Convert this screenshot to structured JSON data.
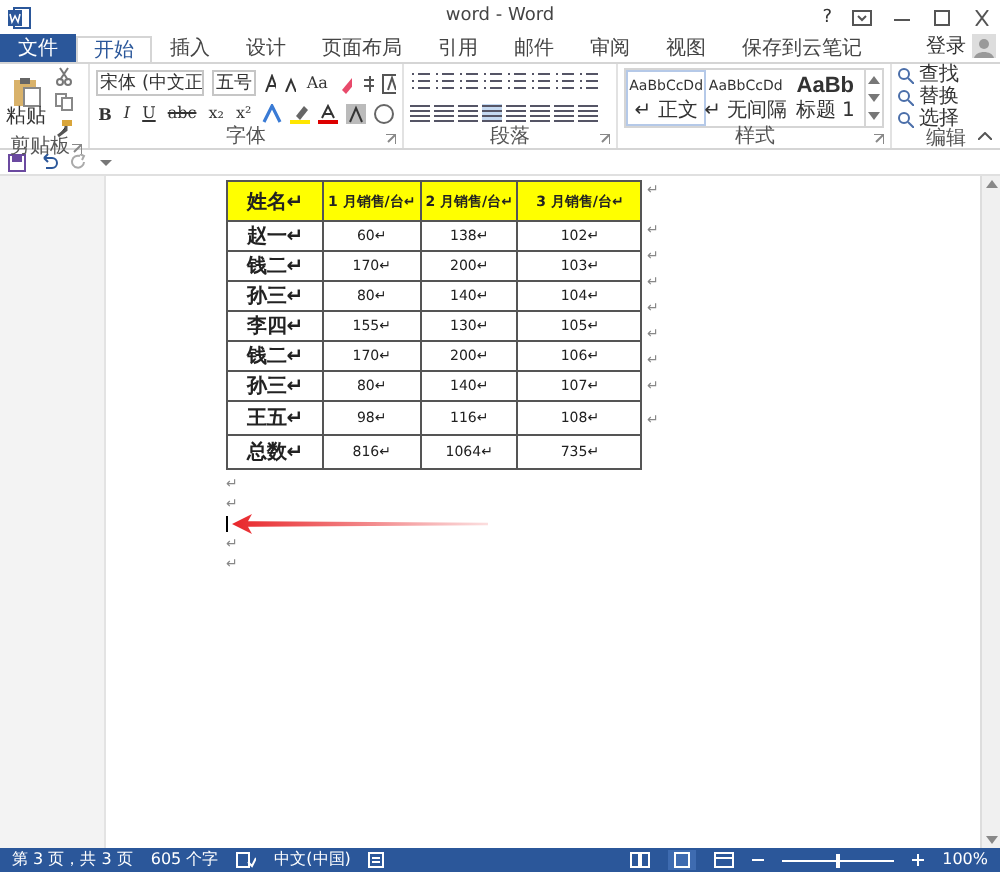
{
  "window": {
    "title": "word - Word",
    "help": "?"
  },
  "tabs": [
    {
      "label": "文件",
      "kind": "file",
      "selected": false
    },
    {
      "label": "开始",
      "kind": "tab",
      "selected": true
    },
    {
      "label": "插入",
      "kind": "tab",
      "selected": false
    },
    {
      "label": "设计",
      "kind": "tab",
      "selected": false
    },
    {
      "label": "页面布局",
      "kind": "tab",
      "selected": false
    },
    {
      "label": "引用",
      "kind": "tab",
      "selected": false
    },
    {
      "label": "邮件",
      "kind": "tab",
      "selected": false
    },
    {
      "label": "审阅",
      "kind": "tab",
      "selected": false
    },
    {
      "label": "视图",
      "kind": "tab",
      "selected": false
    },
    {
      "label": "保存到云笔记",
      "kind": "tab",
      "selected": false
    }
  ],
  "account": {
    "login": "登录"
  },
  "ribbon": {
    "clipboard": {
      "paste": "粘贴",
      "label": "剪贴板"
    },
    "font": {
      "name": "宋体 (中文正",
      "size": "五号",
      "case": "Aa",
      "row2": [
        "B",
        "I",
        "U",
        "abc",
        "x₂",
        "x²"
      ],
      "label": "字体"
    },
    "paragraph": {
      "label": "段落"
    },
    "styles": {
      "items": [
        {
          "sample": "AaBbCcDd",
          "name": "↵ 正文",
          "kind": "normal",
          "selected": true
        },
        {
          "sample": "AaBbCcDd",
          "name": "↵ 无间隔",
          "kind": "normal",
          "selected": false
        },
        {
          "sample": "AaBb",
          "name": "标题 1",
          "kind": "heading",
          "selected": false
        }
      ],
      "label": "样式"
    },
    "editing": {
      "items": [
        "查找",
        "替换",
        "选择"
      ],
      "label": "编辑"
    }
  },
  "table": {
    "columns": [
      "姓名↵",
      "1 月销售/台↵",
      "2 月销售/台↵",
      "3 月销售/台↵"
    ],
    "rows": [
      {
        "cells": [
          "赵一↵",
          "60↵",
          "138↵",
          "102↵"
        ],
        "tall": false,
        "mark": "↵"
      },
      {
        "cells": [
          "钱二↵",
          "170↵",
          "200↵",
          "103↵"
        ],
        "tall": false,
        "mark": "↵"
      },
      {
        "cells": [
          "孙三↵",
          "80↵",
          "140↵",
          "104↵"
        ],
        "tall": false,
        "mark": "↵"
      },
      {
        "cells": [
          "李四↵",
          "155↵",
          "130↵",
          "105↵"
        ],
        "tall": false,
        "mark": "↵"
      },
      {
        "cells": [
          "钱二↵",
          "170↵",
          "200↵",
          "106↵"
        ],
        "tall": false,
        "mark": "↵"
      },
      {
        "cells": [
          "孙三↵",
          "80↵",
          "140↵",
          "107↵"
        ],
        "tall": false,
        "mark": "↵"
      },
      {
        "cells": [
          "王五↵",
          "98↵",
          "116↵",
          "108↵"
        ],
        "tall": true,
        "mark": "↵"
      },
      {
        "cells": [
          "总数↵",
          "816↵",
          "1064↵",
          "735↵"
        ],
        "tall": true,
        "mark": "↵"
      }
    ],
    "mark": "↵"
  },
  "paragraphs": [
    {
      "text": "↵",
      "cursor": false
    },
    {
      "text": "↵",
      "cursor": false
    },
    {
      "cursor": true
    },
    {
      "text": "↵",
      "cursor": false
    },
    {
      "text": "↵",
      "cursor": false
    }
  ],
  "status_bar": {
    "page": "第 3 页，共 3 页",
    "words": "605 个字",
    "language": "中文(中国)",
    "zoom": "100%",
    "zoom_slider": {
      "level": 0.5
    }
  }
}
